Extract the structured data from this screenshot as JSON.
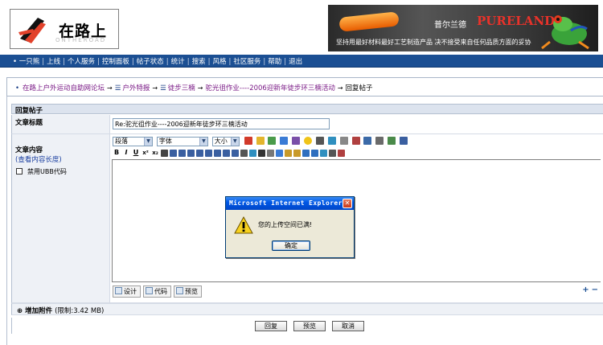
{
  "header": {
    "logo_text": "在路上",
    "logo_subtext": "ONTHEROAD",
    "banner": {
      "brand_cn": "普尔兰德",
      "brand_en": "PURELAND",
      "tagline": "坚持用最好材料最好工艺制造产品  决不接受来自任何品质方面的妥协"
    }
  },
  "nav": {
    "items": [
      "一只熊",
      "上线",
      "个人服务",
      "控制面板",
      "帖子状态",
      "统计",
      "搜索",
      "风格",
      "社区服务",
      "帮助",
      "退出"
    ],
    "separator": "|",
    "bullet": "•"
  },
  "breadcrumb": {
    "items": [
      "在路上户外运动自助网论坛",
      "户外特报",
      "徒步三楠",
      "驼光徂作业----2006迎新年徒步环三楠活动",
      "回复帖子"
    ],
    "arrow": "→"
  },
  "form": {
    "section_title": "回复帖子",
    "title_label": "文章标题",
    "title_value": "Re:驼光徂作业----2006迎新年徒步环三楠活动",
    "content_label": "文章内容",
    "content_hint": "(查看内容长度)",
    "ubb_label": "禁用UBB代码",
    "toolbar": {
      "paragraph": "段落",
      "font": "字体",
      "size": "大小"
    },
    "toolbar2_labels": [
      "B",
      "I",
      "U",
      "x²",
      "x₂"
    ],
    "editor_tabs": [
      {
        "label": "设计"
      },
      {
        "label": "代码"
      },
      {
        "label": "预览"
      }
    ],
    "resize_controls": [
      "+",
      "−"
    ],
    "attach_label": "增加附件",
    "attach_limit": "(限制:3.42 MB)",
    "buttons": {
      "reply": "回复",
      "preview": "预览",
      "cancel": "取消"
    }
  },
  "dialog": {
    "title": "Microsoft Internet Explorer",
    "close": "✕",
    "message": "您的上传空间已满!",
    "ok_label": "确定"
  },
  "colors": {
    "navbar": "#1b4f93",
    "crumb_link": "#7a1a86",
    "dialog_title": "#0058e6"
  }
}
